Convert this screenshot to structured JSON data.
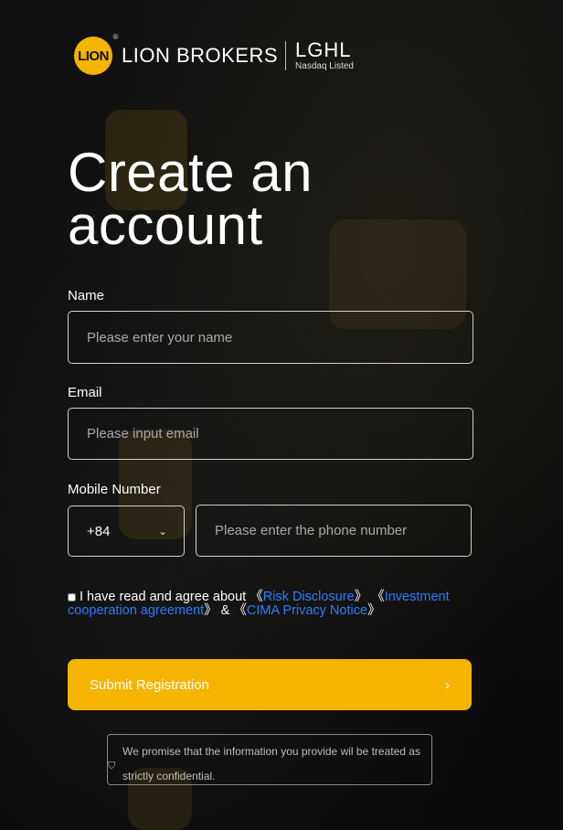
{
  "brand": {
    "badge": "LION",
    "registered": "®",
    "name": "LION BROKERS",
    "lghl": "LGHL",
    "lghl_sub": "Nasdaq Listed"
  },
  "title": "Create an account",
  "form": {
    "name_label": "Name",
    "name_placeholder": "Please enter your name",
    "email_label": "Email",
    "email_placeholder": "Please input email",
    "mobile_label": "Mobile Number",
    "country_code": "+84",
    "phone_placeholder": "Please enter the phone number"
  },
  "agreement": {
    "prefix": "I have read and agree about",
    "open1": "《",
    "risk": "Risk Disclosure",
    "close1": "》",
    "open2": "《",
    "investment": "Investment cooperation agreement",
    "close2": "》",
    "amp": "&",
    "open3": "《",
    "privacy": "CIMA Privacy Notice",
    "close3": "》"
  },
  "submit": {
    "label": "Submit Registration",
    "arrow": "›"
  },
  "notice": {
    "text": "We promise that the information you provide wil be treated as strictly confidential."
  },
  "colors": {
    "accent": "#f5b400",
    "link": "#2f7cff",
    "background": "#0b0b0c"
  },
  "icons": {
    "chevron": "chevron-down-icon",
    "shield": "shield-icon",
    "arrow": "chevron-right-icon"
  }
}
